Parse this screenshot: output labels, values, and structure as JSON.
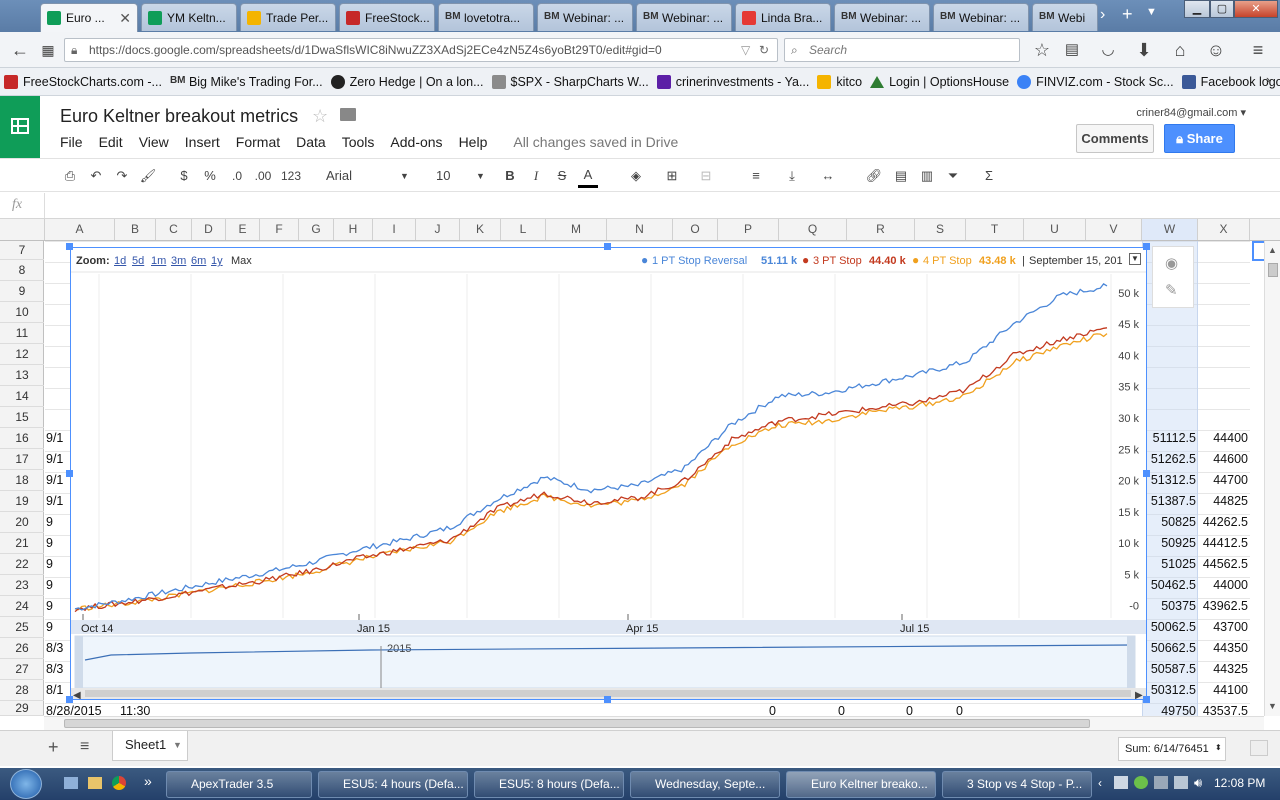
{
  "browser": {
    "tabs": [
      {
        "label": "Euro ...",
        "icon_color": "#0f9d58",
        "active": true
      },
      {
        "label": "YM Keltn...",
        "icon_color": "#0f9d58"
      },
      {
        "label": "Trade Per...",
        "icon_color": "#f4b400"
      },
      {
        "label": "FreeStock...",
        "icon_color": "#c62828"
      },
      {
        "label": "lovetotra...",
        "icon_color": "#ffffff"
      },
      {
        "label": "Webinar: ...",
        "icon_color": "#ffffff"
      },
      {
        "label": "Webinar: ...",
        "icon_color": "#ffffff"
      },
      {
        "label": "Linda Bra...",
        "icon_color": "#e53935"
      },
      {
        "label": "Webinar: ...",
        "icon_color": "#ffffff"
      },
      {
        "label": "Webinar: ...",
        "icon_color": "#ffffff"
      },
      {
        "label": "Webi",
        "icon_color": "#ffffff"
      }
    ],
    "bm_prefix": "BM",
    "url": "https://docs.google.com/spreadsheets/d/1DwaSflsWIC8iNwuZZ3XAdSj2ECe4zN5Z4s6yoBt29T0/edit#gid=0",
    "search_placeholder": "Search",
    "bookmarks": [
      {
        "label": "FreeStockCharts.com -...",
        "icon_color": "#c62828"
      },
      {
        "label": "Big Mike's Trading For...",
        "icon_color": "#ffffff"
      },
      {
        "label": "Zero Hedge | On a lon...",
        "icon_color": "#222222"
      },
      {
        "label": "$SPX - SharpCharts W...",
        "icon_color": "#8b8b8b"
      },
      {
        "label": "crinerinvestments - Ya...",
        "icon_color": "#5c1fa6"
      },
      {
        "label": "kitco",
        "icon_color": "#f5b400"
      },
      {
        "label": "Login | OptionsHouse",
        "icon_color": "#2e7d32"
      },
      {
        "label": "FINVIZ.com - Stock Sc...",
        "icon_color": "#3b82f6"
      },
      {
        "label": "Facebook logo",
        "icon_color": "#3b5998"
      }
    ]
  },
  "sheets": {
    "title": "Euro Keltner breakout metrics",
    "menu": [
      "File",
      "Edit",
      "View",
      "Insert",
      "Format",
      "Data",
      "Tools",
      "Add-ons",
      "Help"
    ],
    "saved_status": "All changes saved in Drive",
    "account": "criner84@gmail.com",
    "comments_label": "Comments",
    "share_label": "Share",
    "toolbar": {
      "currency": "$",
      "percent": "%",
      "dec_less": ".0",
      "dec_more": ".00",
      "format_more": "123",
      "font": "Arial",
      "font_size": "10",
      "bold": "B",
      "italic": "I",
      "strike": "S",
      "text_color": "A"
    },
    "fx_label": "fx",
    "columns": [
      "A",
      "B",
      "C",
      "D",
      "E",
      "F",
      "G",
      "H",
      "I",
      "J",
      "K",
      "L",
      "M",
      "N",
      "O",
      "P",
      "Q",
      "R",
      "S",
      "T",
      "U",
      "V",
      "W",
      "X"
    ],
    "rows": [
      "7",
      "8",
      "9",
      "10",
      "11",
      "12",
      "13",
      "14",
      "15",
      "16",
      "17",
      "18",
      "19",
      "20",
      "21",
      "22",
      "23",
      "24",
      "25",
      "26",
      "27",
      "28",
      "29"
    ],
    "col_a_fragments": [
      "9/1",
      "9/1",
      "9/1",
      "9/1",
      "9",
      "9",
      "9",
      "9",
      "9",
      "9",
      "8/3",
      "8/3",
      "8/1",
      "8/28/2015"
    ],
    "row29": {
      "b": "11:30",
      "p": "0",
      "q": "0",
      "r": "0",
      "s": "0"
    },
    "col_w": [
      "51112.5",
      "51262.5",
      "51312.5",
      "51387.5",
      "50825",
      "50925",
      "51025",
      "50462.5",
      "50375",
      "50062.5",
      "50662.5",
      "50587.5",
      "50312.5",
      "49750"
    ],
    "col_x": [
      "44400",
      "44600",
      "44700",
      "44825",
      "44262.5",
      "44412.5",
      "44562.5",
      "44000",
      "43962.5",
      "43700",
      "44350",
      "44325",
      "44100",
      "43537.5"
    ],
    "col_y_fragments": [
      "4",
      "4",
      "4",
      "4"
    ],
    "sheet_tab": "Sheet1",
    "sum_label": "Sum: 6/14/76451"
  },
  "chart_data": {
    "type": "line",
    "zoom_label": "Zoom:",
    "zoom_options": [
      "1d",
      "5d",
      "1m",
      "3m",
      "6m",
      "1y",
      "Max"
    ],
    "date_label": "September 15, 201",
    "x_ticks": [
      "Oct 14",
      "Jan 15",
      "Apr 15",
      "Jul 15"
    ],
    "navigator_label": "2015",
    "y_ticks": [
      "-0",
      "5 k",
      "10 k",
      "15 k",
      "20 k",
      "25 k",
      "30 k",
      "35 k",
      "40 k",
      "45 k",
      "50 k"
    ],
    "ylim": [
      -1000,
      53000
    ],
    "legend_position": "top",
    "series": [
      {
        "name": "1 PT Stop Reversal",
        "last": "51.11 k",
        "color": "#4a86d8",
        "values": [
          -500,
          800,
          2300,
          3800,
          5200,
          6800,
          8900,
          10500,
          12500,
          17000,
          20500,
          18500,
          19200,
          22000,
          29000,
          33500,
          34000,
          35500,
          37000,
          39000,
          45000,
          49500,
          51100
        ]
      },
      {
        "name": "3 PT Stop",
        "last": "44.40 k",
        "color": "#c33a1f",
        "values": [
          -500,
          400,
          1500,
          2800,
          4000,
          5500,
          7500,
          9000,
          10500,
          15500,
          18000,
          16500,
          17200,
          20000,
          26500,
          29500,
          30500,
          31500,
          32500,
          34500,
          40000,
          42500,
          44400
        ]
      },
      {
        "name": "4 PT Stop",
        "last": "43.48 k",
        "color": "#f0a01e",
        "values": [
          -500,
          300,
          1400,
          2700,
          3900,
          5300,
          7300,
          8800,
          10300,
          15000,
          17500,
          16000,
          16800,
          19500,
          25800,
          28800,
          29500,
          31000,
          32000,
          33500,
          38800,
          41500,
          43480
        ]
      }
    ]
  },
  "taskbar": {
    "items": [
      "ApexTrader 3.5",
      "ESU5: 4 hours (Defa...",
      "ESU5: 8 hours (Defa...",
      "Wednesday, Septe...",
      "Euro Keltner breako...",
      "3 Stop vs 4 Stop - P..."
    ],
    "clock": "12:08 PM"
  }
}
